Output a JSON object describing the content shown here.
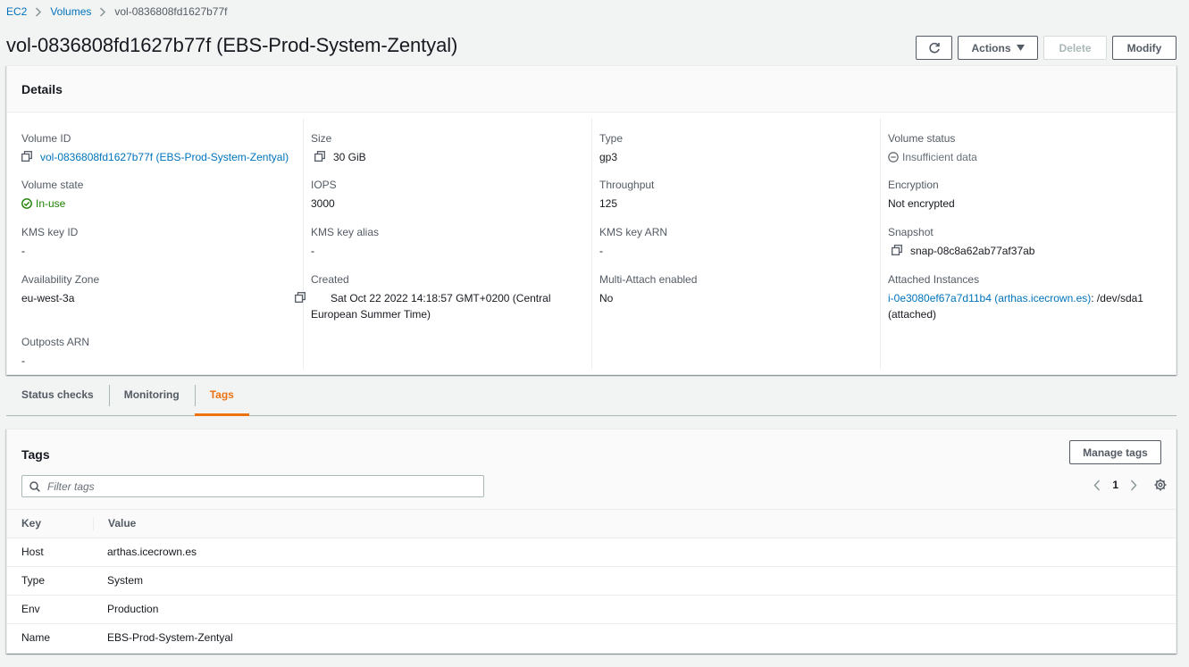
{
  "breadcrumb": {
    "items": [
      "EC2",
      "Volumes"
    ],
    "current": "vol-0836808fd1627b77f"
  },
  "header": {
    "title": "vol-0836808fd1627b77f (EBS-Prod-System-Zentyal)",
    "actions_label": "Actions",
    "delete_label": "Delete",
    "modify_label": "Modify"
  },
  "details": {
    "title": "Details",
    "volume_id": {
      "label": "Volume ID",
      "value": "vol-0836808fd1627b77f (EBS-Prod-System-Zentyal)"
    },
    "volume_state": {
      "label": "Volume state",
      "value": "In-use"
    },
    "kms_key_id": {
      "label": "KMS key ID",
      "value": "-"
    },
    "availability_zone": {
      "label": "Availability Zone",
      "value": "eu-west-3a"
    },
    "outposts_arn": {
      "label": "Outposts ARN",
      "value": "-"
    },
    "size": {
      "label": "Size",
      "value": "30 GiB"
    },
    "iops": {
      "label": "IOPS",
      "value": "3000"
    },
    "kms_key_alias": {
      "label": "KMS key alias",
      "value": "-"
    },
    "created": {
      "label": "Created",
      "value": "Sat Oct 22 2022 14:18:57 GMT+0200 (Central European Summer Time)"
    },
    "type": {
      "label": "Type",
      "value": "gp3"
    },
    "throughput": {
      "label": "Throughput",
      "value": "125"
    },
    "kms_key_arn": {
      "label": "KMS key ARN",
      "value": "-"
    },
    "multi_attach": {
      "label": "Multi-Attach enabled",
      "value": "No"
    },
    "volume_status": {
      "label": "Volume status",
      "value": "Insufficient data"
    },
    "encryption": {
      "label": "Encryption",
      "value": "Not encrypted"
    },
    "snapshot": {
      "label": "Snapshot",
      "value": "snap-08c8a62ab77af37ab"
    },
    "attached_instances": {
      "label": "Attached Instances",
      "instance": "i-0e3080ef67a7d11b4 (arthas.icecrown.es)",
      "device": ": /dev/sda1",
      "state": "(attached)"
    }
  },
  "tabs": [
    {
      "label": "Status checks",
      "active": false
    },
    {
      "label": "Monitoring",
      "active": false
    },
    {
      "label": "Tags",
      "active": true
    }
  ],
  "tags": {
    "title": "Tags",
    "manage_label": "Manage tags",
    "filter_placeholder": "Filter tags",
    "page": "1",
    "columns": [
      "Key",
      "Value"
    ],
    "rows": [
      {
        "key": "Host",
        "value": "arthas.icecrown.es"
      },
      {
        "key": "Type",
        "value": "System"
      },
      {
        "key": "Env",
        "value": "Production"
      },
      {
        "key": "Name",
        "value": "EBS-Prod-System-Zentyal"
      }
    ]
  },
  "colors": {
    "link": "#0073bb",
    "success": "#1d8102",
    "active_tab": "#ec7211",
    "background": "#f2f3f3"
  },
  "icons": [
    "chevron-right-icon",
    "refresh-icon",
    "caret-down-icon",
    "copy-icon",
    "check-circle-icon",
    "minus-circle-icon",
    "search-icon",
    "chevron-left-icon",
    "gear-icon"
  ]
}
